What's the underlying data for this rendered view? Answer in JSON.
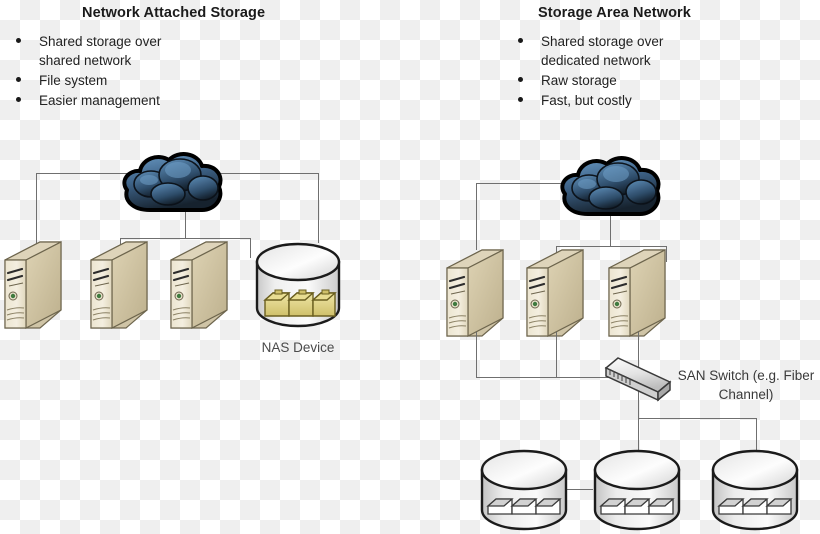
{
  "diagram": {
    "title_left": "Network Attached Storage",
    "title_right": "Storage Area Network",
    "left_bullets": [
      "Shared storage over",
      "shared network",
      "File system",
      "Easier management"
    ],
    "right_bullets": [
      "Shared storage over",
      "dedicated network",
      "Raw storage",
      "Fast, but costly"
    ],
    "labels": {
      "nas_device": "NAS Device",
      "san_switch_line1": "SAN Switch (e.g. Fiber",
      "san_switch_line2": "Channel)"
    },
    "colors": {
      "cloud_light": "#5b8cb8",
      "cloud_mid": "#3c6287",
      "cloud_dark": "#101a24",
      "server_face": "#efe8d4",
      "server_side": "#cfc4a6",
      "server_top": "#ded4ba",
      "led_green": "#3f7a3f",
      "line": "#6f6f6f",
      "cylinder_fill": "#e8e8e8",
      "drive_yellow": "#ded07a",
      "text": "#222222"
    },
    "icons": {
      "cloud": "cloud-icon",
      "server": "server-tower-icon",
      "nas": "nas-cylinder-icon",
      "storage": "storage-cylinder-icon",
      "switch": "network-switch-icon"
    }
  }
}
